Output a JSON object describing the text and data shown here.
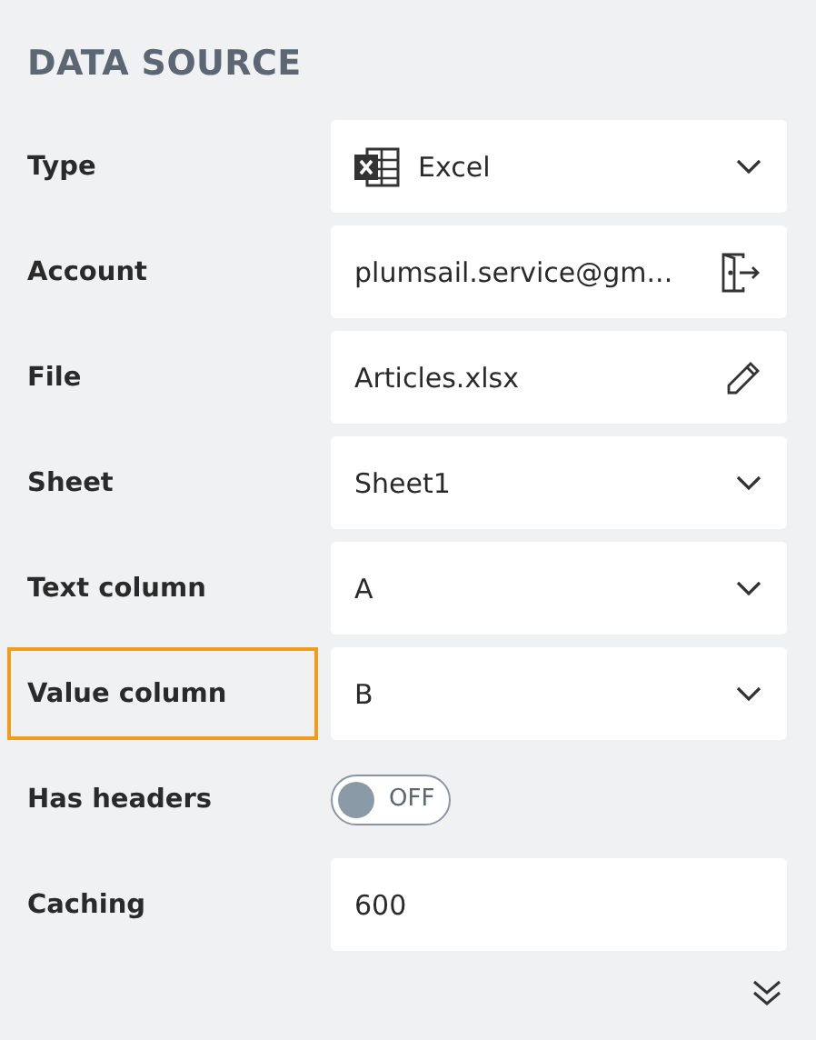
{
  "heading": "DATA SOURCE",
  "rows": [
    {
      "kind": "source_select",
      "label": "Type",
      "value": "Excel",
      "highlighted": false
    },
    {
      "kind": "account",
      "label": "Account",
      "value": "plumsail.service@gm...",
      "highlighted": false
    },
    {
      "kind": "file",
      "label": "File",
      "value": "Articles.xlsx",
      "highlighted": false
    },
    {
      "kind": "select",
      "label": "Sheet",
      "value": "Sheet1",
      "highlighted": false
    },
    {
      "kind": "select",
      "label": "Text column",
      "value": "A",
      "highlighted": false
    },
    {
      "kind": "select",
      "label": "Value column",
      "value": "B",
      "highlighted": true
    },
    {
      "kind": "toggle",
      "label": "Has headers",
      "on": false,
      "state_text": "OFF",
      "highlighted": false
    },
    {
      "kind": "input",
      "label": "Caching",
      "value": "600",
      "highlighted": false
    }
  ]
}
